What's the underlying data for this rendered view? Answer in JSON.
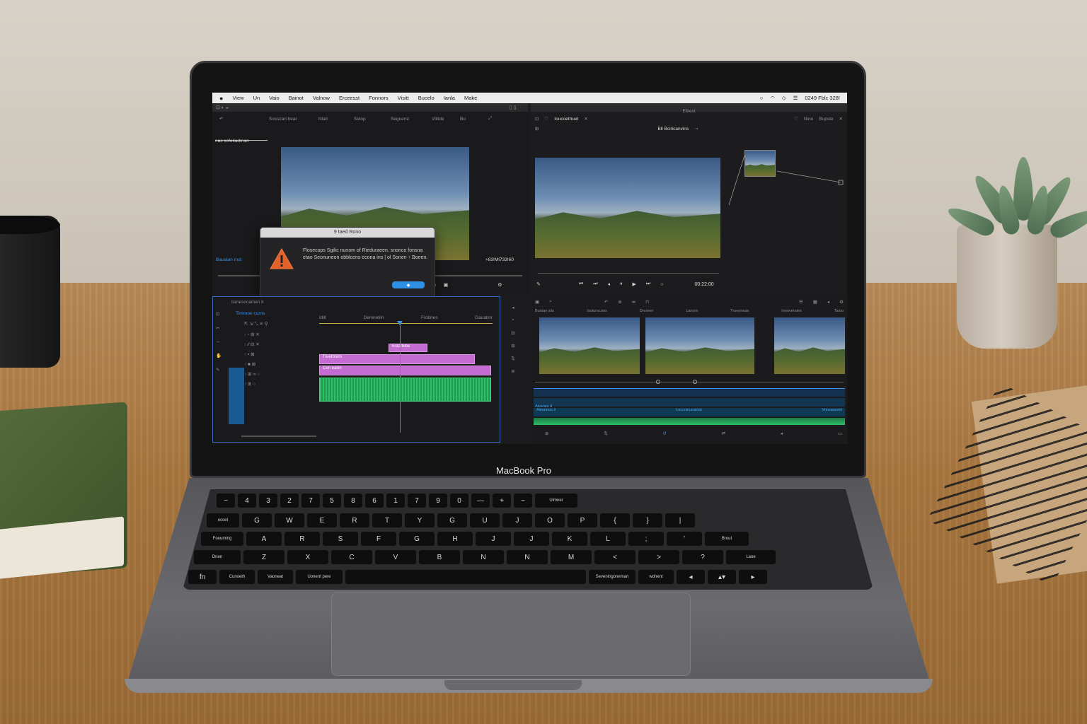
{
  "menubar": {
    "apple": "",
    "items": [
      "View",
      "Un",
      "Vaio",
      "Bainot",
      "Valnow",
      "Erceesst",
      "Fonnors",
      "Visitt",
      "Bucelo",
      "Ianla",
      "Make"
    ],
    "status": "0249 Fblc 328!"
  },
  "left_window": {
    "toolbar": [
      "Sosscari beat",
      "Nlait",
      "Selop",
      "Seguerst",
      "Viitide",
      "Bu"
    ],
    "tab": "nas sofekadman",
    "source_label": "Bauaian mut",
    "timecode": "+83!MI733!60"
  },
  "dialog": {
    "title": "9 taed Rono",
    "message": "Flosecops Sgilic nunom of Rieduraeen. snonco fonsna etao Seonuneon obblcens econa ins | ol Sonen ↑ Boeen.",
    "ok_label": "◆"
  },
  "right_window": {
    "title": "Ellrest",
    "tab": "Ioucoethuet",
    "actions": [
      "Nine",
      "Bupste"
    ],
    "subbar": "Bll  Bciricanvins",
    "playback_timecode": "00:22:00"
  },
  "timeline": {
    "title": "Ismesocamen it",
    "subtitle": "Timrnoe curns",
    "ruler": [
      "Iditi",
      "Deninetiin",
      "Frotines",
      "Gauatinr"
    ],
    "clips": [
      "Estarbibe",
      "Fiuerbrars",
      "Cen eaiiin"
    ]
  },
  "filmstrip": {
    "ruler": [
      "Bustan sits",
      "Iooturocoos",
      "Dreseer",
      "Lanors",
      "Trueoneas",
      "Inooverstes",
      "Taioo"
    ],
    "track_labels": [
      "Alvanes d",
      "Aleurioos #",
      "Leccninunaiion",
      "Vunsanoesi"
    ]
  },
  "laptop": {
    "brand": "MacBook Pro"
  },
  "keyboard": {
    "row1": [
      "~",
      "4",
      "3",
      "2",
      "7",
      "5",
      "8",
      "6",
      "1",
      "7",
      "9",
      "0",
      "—",
      "+",
      "~",
      "Ulmner"
    ],
    "row2": [
      "eccet",
      "G",
      "W",
      "E",
      "R",
      "T",
      "Y",
      "G",
      "U",
      "J",
      "O",
      "P",
      "{",
      "}",
      "|"
    ],
    "row3": [
      "Foeuming",
      "A",
      "R",
      "S",
      "F",
      "G",
      "H",
      "J",
      "J",
      "K",
      "L",
      ";",
      "'",
      "Brout"
    ],
    "row4": [
      "Dnen",
      "Z",
      "X",
      "C",
      "V",
      "B",
      "N",
      "N",
      "M",
      "<",
      ">",
      "?",
      "Laoe"
    ],
    "row5": [
      "fn",
      "Cunoeth",
      "Vaoneat",
      "Uonent pere",
      "",
      "Seveningoneman",
      "wdnent",
      "◂",
      "▴▾",
      "▸"
    ]
  },
  "colors": {
    "accent": "#2e8fe6",
    "clip_purple": "#c36bd1",
    "clip_green": "#2fbf68",
    "playhead": "#3f8fe0"
  }
}
